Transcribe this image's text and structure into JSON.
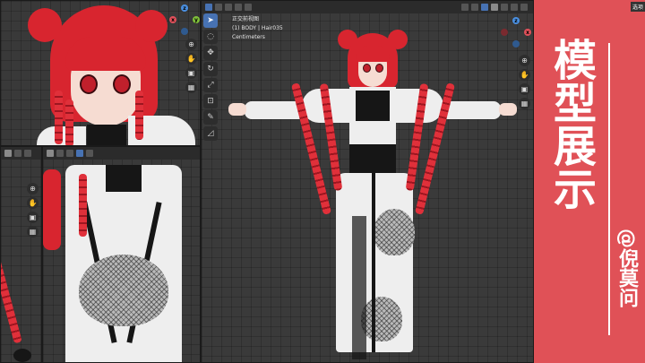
{
  "viewport_main": {
    "view_name": "正交前视图",
    "object_info": "(1) BODY | Hair035",
    "units": "Centimeters"
  },
  "title_card": {
    "title": "模型展示",
    "author": "@倪莫问"
  },
  "corner_label": "选项",
  "colors": {
    "accent_red": "#e05157",
    "hair_red": "#d8252f",
    "viewport_bg": "#393939",
    "active_tool": "#4772b3",
    "gizmo_x": "#e0505a",
    "gizmo_y": "#7fbf3a",
    "gizmo_z": "#4a8fe0"
  },
  "icons": [
    "cursor-icon",
    "select-box-icon",
    "move-icon",
    "rotate-icon",
    "scale-icon",
    "transform-icon",
    "annotate-icon",
    "measure-icon",
    "zoom-icon",
    "hand-icon",
    "camera-icon",
    "grid-icon"
  ]
}
